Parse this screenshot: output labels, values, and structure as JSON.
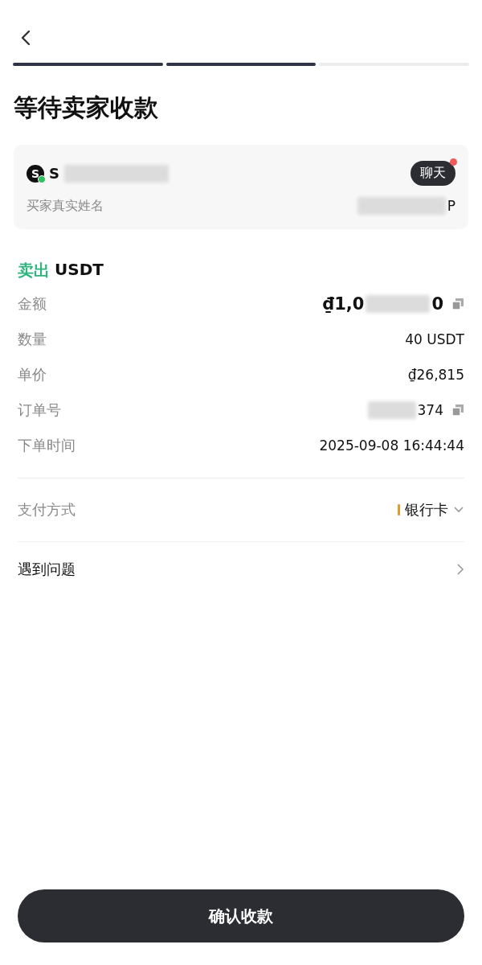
{
  "progress": [
    {
      "completed": true
    },
    {
      "completed": true
    },
    {
      "completed": false
    }
  ],
  "title": "等待卖家收款",
  "counterparty": {
    "avatar_letter": "S",
    "online": true,
    "name": "S",
    "chat": {
      "label": "聊天",
      "unread": true
    },
    "real_name_label": "买家真实姓名",
    "real_name": "P"
  },
  "order": {
    "side": "卖出",
    "asset": "USDT",
    "rows": [
      {
        "label": "金额",
        "value_start": "₫1,0",
        "value_end": "0",
        "redacted": true,
        "copyable": true,
        "emphasis": true
      },
      {
        "label": "数量",
        "value_end": "40 USDT",
        "redacted": false,
        "copyable": false,
        "emphasis": false
      },
      {
        "label": "单价",
        "value_end": "₫26,815",
        "redacted": false,
        "copyable": false,
        "emphasis": false
      },
      {
        "label": "订单号",
        "value_end": "374",
        "redacted": true,
        "copyable": true,
        "emphasis": false
      },
      {
        "label": "下单时间",
        "value_end": "2025-09-08 16:44:44",
        "redacted": false,
        "copyable": false,
        "emphasis": false
      }
    ]
  },
  "payment": {
    "label": "支付方式",
    "method": "银行卡",
    "color": "#e59a2f"
  },
  "problem": {
    "label": "遇到问题"
  },
  "confirm_button": "确认收款"
}
